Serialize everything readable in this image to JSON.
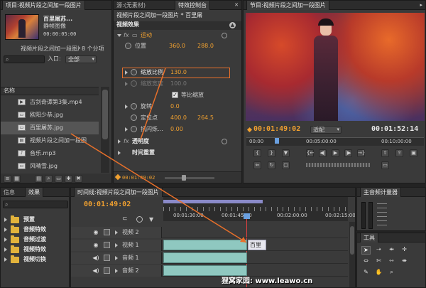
{
  "project": {
    "tab": "项目:视频片段之间加一段图片",
    "clip_name": "百里屠苏...",
    "clip_type": "静帧图像",
    "clip_duration": "00:00:05:00",
    "project_file": "视频片段之间加一段图片.prproj",
    "item_count": "8 个分项",
    "search_placeholder": "",
    "in_label": "入口:",
    "in_value": "全部",
    "column_name": "名称",
    "files": [
      {
        "name": "古剑奇谭第3集.mp4",
        "type": "video"
      },
      {
        "name": "欧阳少恭.jpg",
        "type": "image"
      },
      {
        "name": "百里屠苏.jpg",
        "type": "image"
      },
      {
        "name": "视频片段之间加一段图",
        "type": "sequence"
      },
      {
        "name": "音乐.mp3",
        "type": "audio"
      },
      {
        "name": "风晴雪.jpg",
        "type": "image"
      }
    ]
  },
  "source_tab": "源:(无素材)",
  "effects_control": {
    "tab": "特效控制台",
    "header": "视频片段之间加一段图片 * 百里屠",
    "section": "视频效果",
    "motion": "运动",
    "position_label": "位置",
    "position_x": "360.0",
    "position_y": "288.0",
    "scale_label": "缩放比例",
    "scale_value": "130.0",
    "scale_width_label": "缩放宽度",
    "scale_width_value": "100.0",
    "uniform_label": "等比缩放",
    "rotation_label": "旋转",
    "rotation_value": "0.0",
    "anchor_label": "定位点",
    "anchor_x": "400.0",
    "anchor_y": "264.5",
    "flicker_label": "抗闪烁...",
    "flicker_value": "0.00",
    "opacity": "透明度",
    "time_remap": "时间重置",
    "timecode": "00:01:49:02"
  },
  "program": {
    "tab": "节目:视频片段之间加一段图片",
    "timecode_left": "00:01:49:02",
    "fit": "适配",
    "timecode_right": "00:01:52:14",
    "ruler_labels": [
      "00:00",
      "00:05:00:00",
      "00:10:00:00"
    ]
  },
  "effects_panel": {
    "tabs": [
      "信息",
      "效果"
    ],
    "items": [
      "预置",
      "音频特效",
      "音频过渡",
      "视频特效",
      "视频切换"
    ]
  },
  "timeline": {
    "tab": "时间线:视频片段之间加一段图片",
    "timecode": "00:01:49:02",
    "ruler_labels": [
      "00:01:30:00",
      "00:01:45:00",
      "00:02:00:00",
      "00:02:15:00"
    ],
    "tracks": [
      {
        "name": "视频 2",
        "kind": "video"
      },
      {
        "name": "视频 1",
        "kind": "video"
      },
      {
        "name": "音频 1",
        "kind": "audio"
      },
      {
        "name": "音频 2",
        "kind": "audio"
      }
    ],
    "clip_label": "百里"
  },
  "audio_master_tab": "主音频计量器",
  "tools_tab": "工具",
  "watermark": "狸窝家园: www.leawo.cn",
  "colors": {
    "accent": "#f0a030",
    "highlight_box": "#e8702a",
    "clip": "#8fc8c0"
  }
}
